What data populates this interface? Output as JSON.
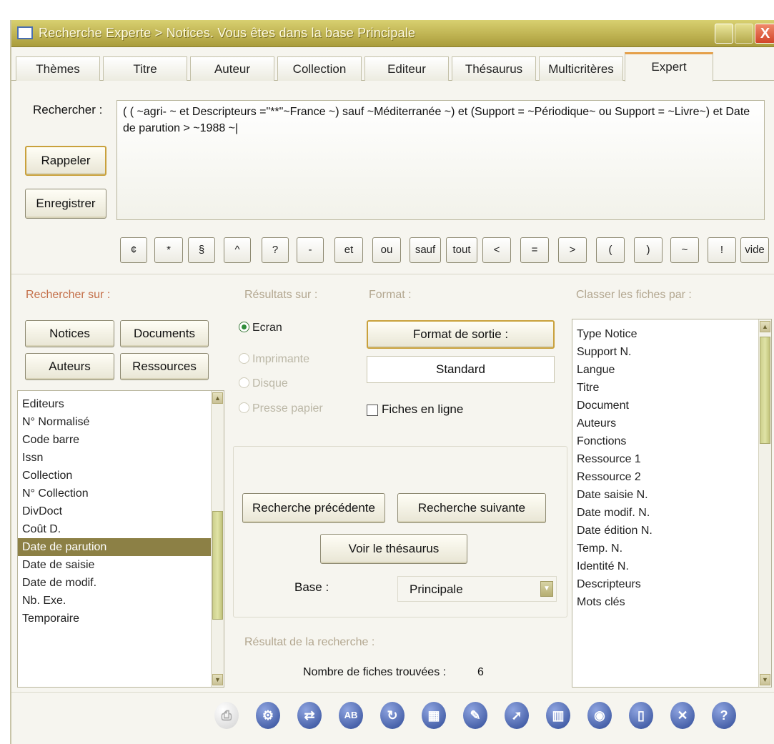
{
  "window": {
    "title": "Recherche Experte > Notices.  Vous êtes dans la base Principale",
    "close_glyph": "X"
  },
  "tabs": [
    "Thèmes",
    "Titre",
    "Auteur",
    "Collection",
    "Editeur",
    "Thésaurus",
    "Multicritères",
    "Expert"
  ],
  "active_tab": "Expert",
  "search": {
    "label": "Rechercher :",
    "query": "( ( ~agri- ~ et Descripteurs =\"**\"~France ~) sauf ~Méditerranée ~) et (Support = ~Périodique~ ou Support = ~Livre~) et Date de parution > ~1988 ~|",
    "recall_button": "Rappeler",
    "save_button": "Enregistrer"
  },
  "operators": [
    "¢",
    "*",
    "§",
    "^",
    "?",
    "-",
    "et",
    "ou",
    "sauf",
    "tout",
    "<",
    "=",
    ">",
    "(",
    ")",
    "~",
    "!",
    "vide"
  ],
  "search_on": {
    "title": "Rechercher sur :",
    "buttons": [
      "Notices",
      "Documents",
      "Auteurs",
      "Ressources"
    ],
    "fields": [
      "Editeurs",
      "N° Normalisé",
      "Code barre",
      "Issn",
      "Collection",
      "N° Collection",
      "DivDoct",
      "Coût D.",
      "Date de parution",
      "Date de saisie",
      "Date de modif.",
      "Nb. Exe.",
      "Temporaire"
    ],
    "selected": "Date de parution"
  },
  "results_on": {
    "title": "Résultats sur :",
    "options": [
      "Ecran",
      "Imprimante",
      "Disque",
      "Presse papier"
    ],
    "selected": "Ecran"
  },
  "format": {
    "title": "Format :",
    "output_button": "Format de sortie :",
    "value": "Standard",
    "inline_label": "Fiches en ligne"
  },
  "navigation": {
    "previous": "Recherche précédente",
    "next": "Recherche suivante",
    "thesaurus": "Voir le thésaurus",
    "base_label": "Base :",
    "base_value": "Principale"
  },
  "result": {
    "title": "Résultat de la recherche :",
    "count_label": "Nombre de fiches trouvées :",
    "count": "6"
  },
  "sort": {
    "title": "Classer les fiches par :",
    "items": [
      "Type Notice",
      "Support N.",
      "Langue",
      "Titre",
      "Document",
      "Auteurs",
      "Fonctions",
      "Ressource 1",
      "Ressource 2",
      "Date saisie N.",
      "Date modif. N.",
      "Date édition N.",
      "Temp. N.",
      "Identité N.",
      "Descripteurs",
      "Mots clés"
    ]
  },
  "toolbar_icons": [
    {
      "name": "print-icon",
      "color": "#c9c9c9"
    },
    {
      "name": "settings-icon",
      "color": "#3b5aa8"
    },
    {
      "name": "shuffle-icon",
      "color": "#3c4fa0"
    },
    {
      "name": "spellcheck-icon",
      "color": "#34488f"
    },
    {
      "name": "refresh-icon",
      "color": "#2f468c"
    },
    {
      "name": "grid-icon",
      "color": "#2a3f86"
    },
    {
      "name": "edit-icon",
      "color": "#3a55a3"
    },
    {
      "name": "cursor-icon",
      "color": "#3d5aa8"
    },
    {
      "name": "trash-icon",
      "color": "#3a5299"
    },
    {
      "name": "eye-icon",
      "color": "#3a5aa6"
    },
    {
      "name": "document-icon",
      "color": "#3b52a0"
    },
    {
      "name": "close-icon",
      "color": "#34498e"
    },
    {
      "name": "help-icon",
      "color": "#3d5ab0"
    }
  ]
}
